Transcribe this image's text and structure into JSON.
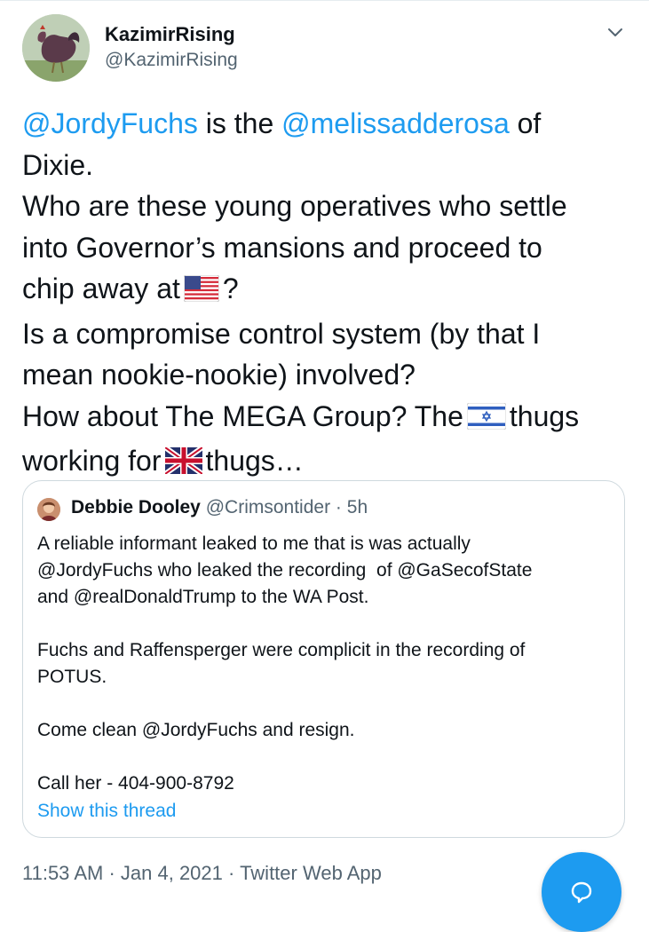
{
  "author": {
    "name": "KazimirRising",
    "handle": "@KazimirRising"
  },
  "tweet": {
    "lines": [
      {
        "m1": "@JordyFuchs",
        "t1": " is the ",
        "m2": "@melissadderosa",
        "t2": " of"
      },
      {
        "text": "Dixie."
      },
      {
        "text": "Who are these young operatives who settle"
      },
      {
        "text": "into Governor’s mansions and proceed to"
      },
      {
        "pre": "chip away at",
        "post": "?",
        "flag": "us-flag-icon"
      },
      {
        "text": "Is a compromise control system (by that I"
      },
      {
        "text": "mean nookie-nookie) involved?"
      },
      {
        "pre": "How about The MEGA Group? The",
        "post": "thugs",
        "flag": "israel-flag-icon"
      },
      {
        "pre": "working for",
        "post": "thugs…",
        "flag": "uk-flag-icon"
      }
    ]
  },
  "quote": {
    "name": "Debbie Dooley",
    "handle": "@Crimsontider",
    "separator": "·",
    "time": "5h",
    "lines": [
      "A reliable informant leaked to me that is was actually",
      "@JordyFuchs who leaked the recording  of @GaSecofState",
      "and @realDonaldTrump to the WA Post.",
      "",
      "Fuchs and Raffensperger were complicit in the recording of",
      "POTUS.",
      "",
      "Come clean @JordyFuchs and resign.",
      "",
      "Call her - 404-900-8792"
    ],
    "show_thread": "Show this thread"
  },
  "meta": {
    "time": "11:53 AM",
    "sep1": "·",
    "date": "Jan 4, 2021",
    "sep2": "·",
    "source": "Twitter Web App"
  },
  "colors": {
    "accent": "#1d9bf0",
    "text": "#0f1419",
    "secondary": "#536471"
  },
  "icons": {
    "caret": "chevron-down-icon",
    "reply": "reply-icon"
  }
}
